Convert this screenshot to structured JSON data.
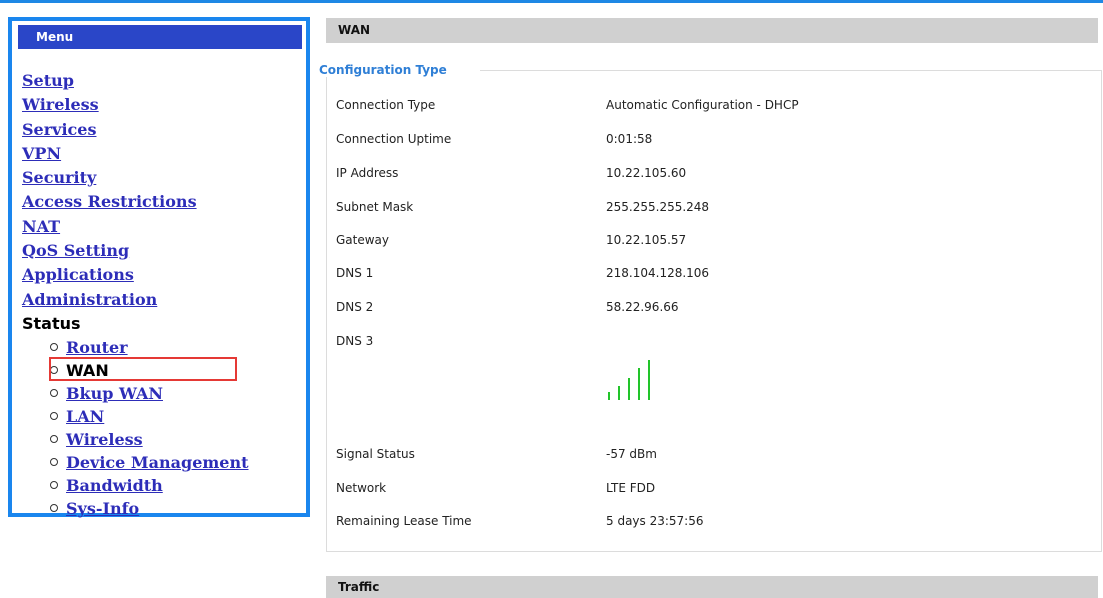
{
  "sidebar": {
    "header": "Menu",
    "items": [
      {
        "label": "Setup"
      },
      {
        "label": "Wireless"
      },
      {
        "label": "Services"
      },
      {
        "label": "VPN"
      },
      {
        "label": "Security"
      },
      {
        "label": "Access Restrictions"
      },
      {
        "label": "NAT"
      },
      {
        "label": "QoS Setting"
      },
      {
        "label": "Applications"
      },
      {
        "label": "Administration"
      }
    ],
    "status_label": "Status",
    "status_items": [
      {
        "label": "Router"
      },
      {
        "label": "WAN"
      },
      {
        "label": "Bkup WAN"
      },
      {
        "label": "LAN"
      },
      {
        "label": "Wireless"
      },
      {
        "label": "Device Management"
      },
      {
        "label": "Bandwidth"
      },
      {
        "label": "Sys-Info"
      }
    ]
  },
  "wan": {
    "title": "WAN",
    "legend": "Configuration Type",
    "rows": [
      {
        "label": "Connection Type",
        "value": "Automatic Configuration - DHCP"
      },
      {
        "label": "Connection Uptime",
        "value": "0:01:58"
      },
      {
        "label": "IP Address",
        "value": "10.22.105.60"
      },
      {
        "label": "Subnet Mask",
        "value": "255.255.255.248"
      },
      {
        "label": "Gateway",
        "value": "10.22.105.57"
      },
      {
        "label": "DNS 1",
        "value": "218.104.128.106"
      },
      {
        "label": "DNS 2",
        "value": "58.22.96.66"
      },
      {
        "label": "DNS 3",
        "value": ""
      },
      {
        "label": "Signal Status",
        "value": "-57 dBm"
      },
      {
        "label": "Network",
        "value": "LTE FDD"
      },
      {
        "label": "Remaining Lease Time",
        "value": "5 days 23:57:56"
      }
    ],
    "signal_bars": 5,
    "signal_color": "#22c42a"
  },
  "traffic": {
    "title": "Traffic"
  },
  "colors": {
    "accent": "#1a86ee",
    "menu_header_bg": "#2a46c8",
    "link": "#2d2db8",
    "highlight": "#e53935",
    "legend": "#2f7fd6"
  }
}
